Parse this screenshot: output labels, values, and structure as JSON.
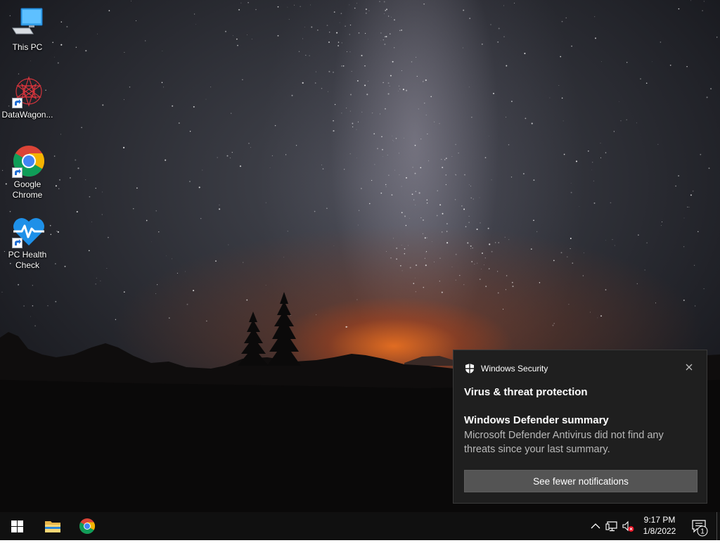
{
  "desktop": {
    "icons": [
      {
        "label": "This PC",
        "icon": "computer-icon",
        "shortcut": false
      },
      {
        "label": "DataWagon...",
        "icon": "datawagon-app-icon",
        "shortcut": true
      },
      {
        "label": "Google Chrome",
        "icon": "chrome-icon",
        "shortcut": true
      },
      {
        "label": "PC Health Check",
        "icon": "health-check-icon",
        "shortcut": true
      }
    ]
  },
  "notification": {
    "app_name": "Windows Security",
    "app_icon": "shield-icon",
    "title": "Virus & threat protection",
    "subtitle": "Windows Defender summary",
    "body": "Microsoft Defender Antivirus did not find any threats since your last summary.",
    "button_label": "See fewer notifications",
    "close_icon": "close-icon"
  },
  "taskbar": {
    "start_icon": "windows-logo-icon",
    "pinned": [
      {
        "name": "File Explorer",
        "icon": "folder-icon"
      },
      {
        "name": "Google Chrome",
        "icon": "chrome-icon"
      }
    ],
    "tray": {
      "overflow_icon": "chevron-up-icon",
      "network_icon": "network-icon",
      "volume_icon": "volume-muted-icon",
      "time": "9:17 PM",
      "date": "1/8/2022",
      "action_center_icon": "action-center-icon",
      "notification_count": "1"
    }
  },
  "colors": {
    "taskbar_bg": "#101010",
    "toast_bg": "#1f1f1f",
    "toast_button_bg": "#545454",
    "accent_blue": "#0078d7"
  }
}
